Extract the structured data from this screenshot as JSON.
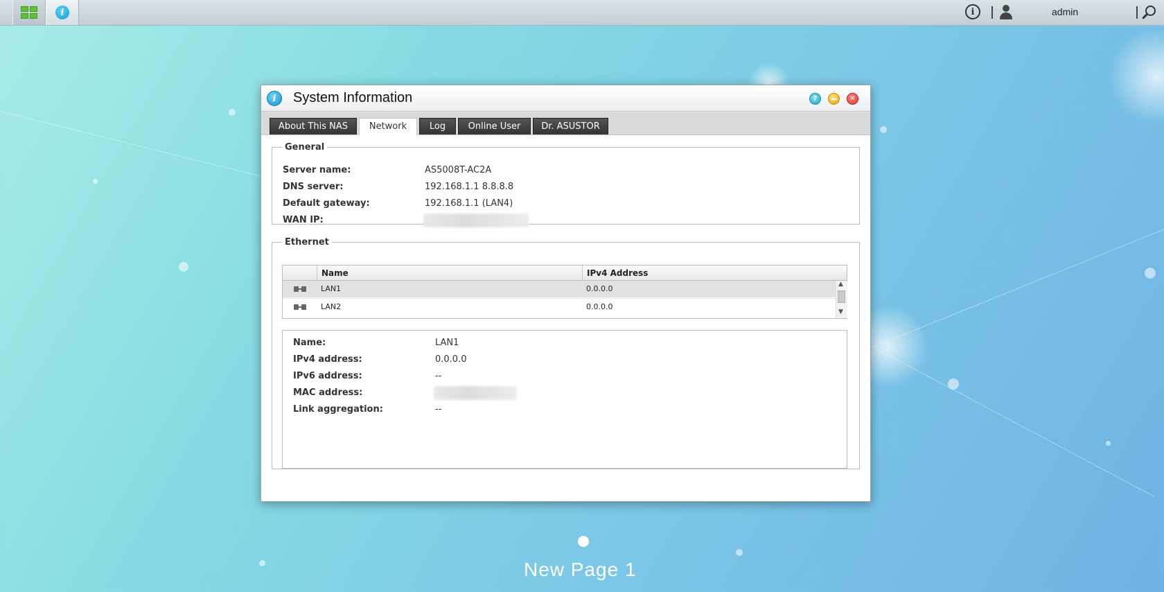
{
  "topbar": {
    "username": "admin",
    "info_glyph": "i",
    "icons": [
      "app-launcher-icon",
      "system-info-icon",
      "info-icon",
      "user-icon",
      "search-icon"
    ]
  },
  "window": {
    "title": "System Information",
    "icon_glyph": "i",
    "help_glyph": "?",
    "close_glyph": "✕",
    "tabs": [
      {
        "label": "About This NAS"
      },
      {
        "label": "Network"
      },
      {
        "label": "Log"
      },
      {
        "label": "Online User"
      },
      {
        "label": "Dr. ASUSTOR"
      }
    ],
    "active_tab": "Network"
  },
  "general": {
    "legend": "General",
    "server_name_label": "Server name:",
    "server_name": "AS5008T-AC2A",
    "dns_label": "DNS server:",
    "dns": "192.168.1.1 8.8.8.8",
    "gateway_label": "Default gateway:",
    "gateway": "192.168.1.1 (LAN4)",
    "wan_label": "WAN IP:"
  },
  "ethernet": {
    "legend": "Ethernet",
    "columns": [
      "Name",
      "IPv4 Address"
    ],
    "rows": [
      {
        "name": "LAN1",
        "ipv4": "0.0.0.0",
        "selected": true
      },
      {
        "name": "LAN2",
        "ipv4": "0.0.0.0",
        "selected": false
      }
    ],
    "scroll_up": "▲",
    "scroll_down": "▼"
  },
  "details": {
    "name_label": "Name:",
    "name": "LAN1",
    "ipv4_label": "IPv4 address:",
    "ipv4": "0.0.0.0",
    "ipv6_label": "IPv6 address:",
    "ipv6": "--",
    "mac_label": "MAC address:",
    "agg_label": "Link aggregation:",
    "agg": "--"
  },
  "desktop": {
    "page_label": "New Page 1"
  },
  "colors": {
    "desktop_bg": "#86dbe2",
    "tab_dark": "#333333",
    "accent_green": "#5cc236"
  }
}
